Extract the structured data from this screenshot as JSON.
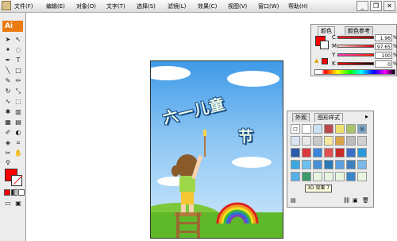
{
  "menubar": {
    "items": [
      "文件(F)",
      "编辑(E)",
      "对象(O)",
      "文字(T)",
      "选择(S)",
      "滤镜(L)",
      "效果(C)",
      "视图(V)",
      "窗口(W)",
      "帮助(H)"
    ]
  },
  "toolbox": {
    "logo": "Ai"
  },
  "artwork": {
    "title_line1": "六一儿童",
    "title_line2": "节"
  },
  "color_panel": {
    "tabs": [
      "颜色",
      "颜色参考"
    ],
    "channels": [
      {
        "label": "C",
        "value": "1.96"
      },
      {
        "label": "M",
        "value": "97.65"
      },
      {
        "label": "Y",
        "value": "100"
      },
      {
        "label": "K",
        "value": "0"
      }
    ],
    "unit": "%",
    "fill_color": "#ff0000"
  },
  "graphic_styles_panel": {
    "tabs": [
      "外观",
      "图形样式"
    ],
    "tooltip": "3D 效果 7"
  },
  "colors": {
    "accent": "#ea7b10",
    "fill": "#ff0000"
  }
}
